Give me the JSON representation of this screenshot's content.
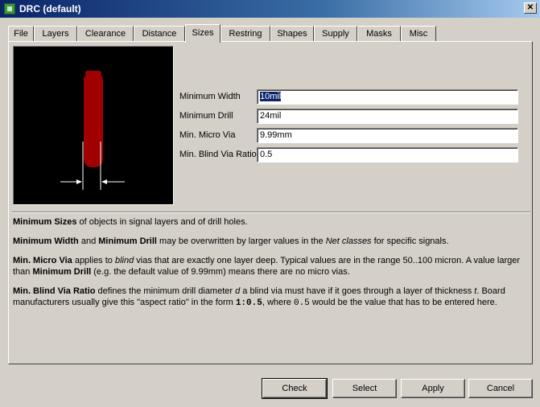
{
  "window": {
    "title": "DRC (default)",
    "close_glyph": "✕"
  },
  "tabs": [
    {
      "label": "File"
    },
    {
      "label": "Layers"
    },
    {
      "label": "Clearance"
    },
    {
      "label": "Distance"
    },
    {
      "label": "Sizes"
    },
    {
      "label": "Restring"
    },
    {
      "label": "Shapes"
    },
    {
      "label": "Supply"
    },
    {
      "label": "Masks"
    },
    {
      "label": "Misc"
    }
  ],
  "active_tab": "Sizes",
  "fields": [
    {
      "label": "Minimum Width",
      "value": "10mil"
    },
    {
      "label": "Minimum Drill",
      "value": "24mil"
    },
    {
      "label": "Min. Micro Via",
      "value": "9.99mm"
    },
    {
      "label": "Min. Blind Via Ratio",
      "value": "0.5"
    }
  ],
  "preview": {
    "trace_color": "#a00000",
    "background": "#000000"
  },
  "help": {
    "p1": {
      "b1": "Minimum Sizes",
      "t1": " of objects in signal layers and of drill holes."
    },
    "p2": {
      "b1": "Minimum Width",
      "t1": " and ",
      "b2": "Minimum Drill",
      "t2": " may be overwritten by larger values in the ",
      "i1": "Net classes",
      "t3": " for specific signals."
    },
    "p3": {
      "b1": "Min. Micro Via",
      "t1": " applies to ",
      "i1": "blind",
      "t2": " vias that are exactly one layer deep. Typical values are in the range 50..100 micron. A value larger than ",
      "b2": "Minimum Drill",
      "t3": " (e.g. the default value of 9.99mm) means there are no micro vias."
    },
    "p4": {
      "b1": "Min. Blind Via Ratio",
      "t1": " defines the minimum drill diameter ",
      "i1": "d",
      "t2": " a blind via must have if it goes through a layer of thickness ",
      "i2": "t",
      "t3": ". Board manufacturers usually give this \"aspect ratio\" in the form ",
      "m1": "1:0.5",
      "t4": ", where ",
      "m2": "0.5",
      "t5": " would be the value that has to be entered here."
    }
  },
  "buttons": {
    "check": "Check",
    "select": "Select",
    "apply": "Apply",
    "cancel": "Cancel"
  }
}
